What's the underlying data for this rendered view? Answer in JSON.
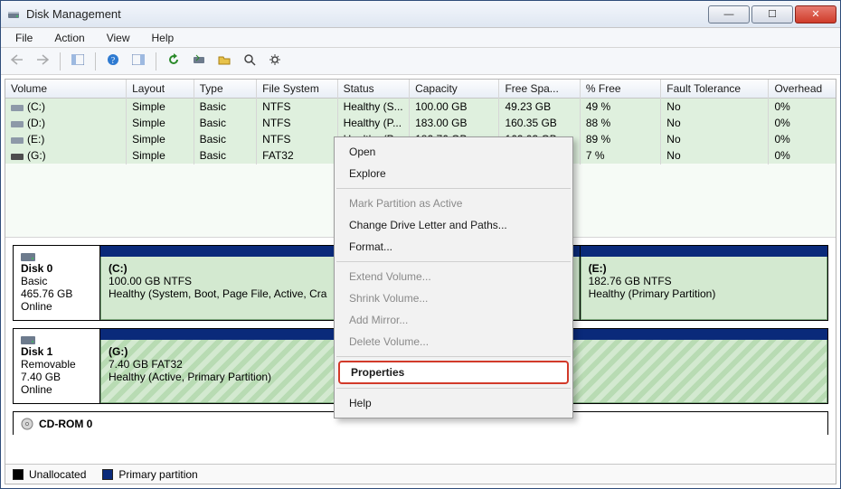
{
  "window": {
    "title": "Disk Management",
    "buttons": {
      "min": "—",
      "max": "☐",
      "close": "✕"
    }
  },
  "menu": {
    "file": "File",
    "action": "Action",
    "view": "View",
    "help": "Help"
  },
  "columns": {
    "volume": "Volume",
    "layout": "Layout",
    "type": "Type",
    "fs": "File System",
    "status": "Status",
    "capacity": "Capacity",
    "free": "Free Spa...",
    "pctfree": "% Free",
    "fault": "Fault Tolerance",
    "overhead": "Overhead"
  },
  "volumes": [
    {
      "name": "(C:)",
      "layout": "Simple",
      "type": "Basic",
      "fs": "NTFS",
      "status": "Healthy (S...",
      "capacity": "100.00 GB",
      "free": "49.23 GB",
      "pctfree": "49 %",
      "fault": "No",
      "overhead": "0%"
    },
    {
      "name": "(D:)",
      "layout": "Simple",
      "type": "Basic",
      "fs": "NTFS",
      "status": "Healthy (P...",
      "capacity": "183.00 GB",
      "free": "160.35 GB",
      "pctfree": "88 %",
      "fault": "No",
      "overhead": "0%"
    },
    {
      "name": "(E:)",
      "layout": "Simple",
      "type": "Basic",
      "fs": "NTFS",
      "status": "Healthy (P...",
      "capacity": "182.76 GB",
      "free": "162.03 GB",
      "pctfree": "89 %",
      "fault": "No",
      "overhead": "0%"
    },
    {
      "name": "(G:)",
      "layout": "Simple",
      "type": "Basic",
      "fs": "FAT32",
      "status": "",
      "capacity": "",
      "free": "",
      "pctfree": "7 %",
      "fault": "No",
      "overhead": "0%"
    }
  ],
  "context_menu": {
    "open": "Open",
    "explore": "Explore",
    "mark_active": "Mark Partition as Active",
    "change_letter": "Change Drive Letter and Paths...",
    "format": "Format...",
    "extend": "Extend Volume...",
    "shrink": "Shrink Volume...",
    "add_mirror": "Add Mirror...",
    "delete": "Delete Volume...",
    "properties": "Properties",
    "help": "Help"
  },
  "disks": {
    "d0": {
      "name": "Disk 0",
      "type": "Basic",
      "size": "465.76 GB",
      "state": "Online",
      "p0": {
        "name": "(C:)",
        "line2": "100.00 GB NTFS",
        "line3": "Healthy (System, Boot, Page File, Active, Cra"
      },
      "p1": {
        "name": "(E:)",
        "line2": "182.76 GB NTFS",
        "line3": "Healthy (Primary Partition)"
      }
    },
    "d1": {
      "name": "Disk 1",
      "type": "Removable",
      "size": "7.40 GB",
      "state": "Online",
      "p0": {
        "name": "(G:)",
        "line2": "7.40 GB FAT32",
        "line3": "Healthy (Active, Primary Partition)"
      }
    },
    "cdrom": {
      "name": "CD-ROM 0"
    }
  },
  "legend": {
    "unalloc": "Unallocated",
    "primary": "Primary partition"
  }
}
